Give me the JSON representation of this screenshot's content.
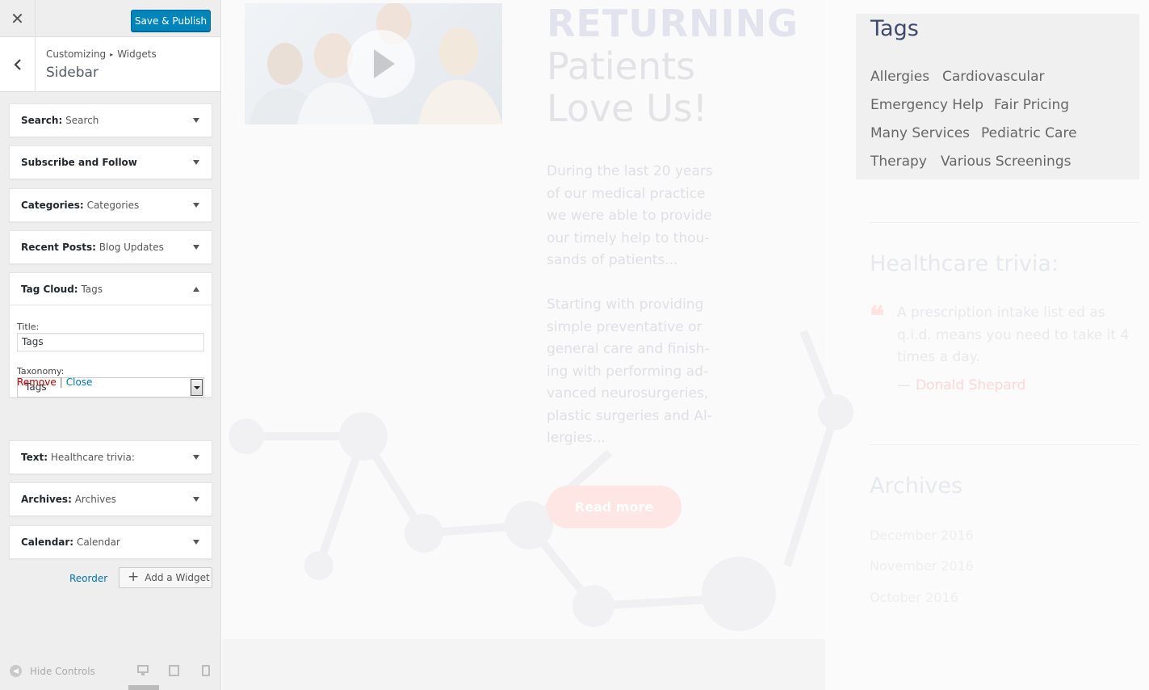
{
  "customizer": {
    "close_glyph": "✕",
    "save_label": "Save & Publish",
    "back_glyph": "‹",
    "breadcrumb_parent": "Customizing",
    "breadcrumb_separator": "▸",
    "breadcrumb_child": "Widgets",
    "panel_title": "Sidebar",
    "widgets": [
      {
        "label": "Search:",
        "title": "Search"
      },
      {
        "label": "Subscribe and Follow",
        "title": ""
      },
      {
        "label": "Categories:",
        "title": "Categories"
      },
      {
        "label": "Recent Posts:",
        "title": "Blog Updates"
      },
      {
        "label": "Tag Cloud:",
        "title": "Tags"
      },
      {
        "label": "Text:",
        "title": "Healthcare trivia:"
      },
      {
        "label": "Archives:",
        "title": "Archives"
      },
      {
        "label": "Calendar:",
        "title": "Calendar"
      }
    ],
    "open_widget": {
      "title_label": "Title:",
      "title_value": "Tags",
      "taxonomy_label": "Taxonomy:",
      "taxonomy_selected": "Tags",
      "remove_label": "Remove",
      "separator": "|",
      "close_label": "Close"
    },
    "reorder_label": "Reorder",
    "add_widget_plus": "+",
    "add_widget_label": "Add a Widget",
    "hide_controls_label": "Hide Controls",
    "hide_controls_glyph": "◀"
  },
  "preview": {
    "heading_top": "RETURNING",
    "heading_main": "Patients Love Us!",
    "paragraph_1": "During the last 20 years of our medical practice we were able to provide our timely help to thou-sands of patients...",
    "paragraph_2": "Starting with providing simple preventative or general care and finish-ing with performing ad-vanced neurosurgeries, plastic surgeries and Al-lergies...",
    "read_more": "Read more",
    "tags_title": "Tags",
    "tags": [
      "Allergies",
      "Cardiovascular",
      "Emergency Help",
      "Fair Pricing",
      "Many Services",
      "Pediatric Care",
      "Therapy",
      "Various Screenings"
    ],
    "trivia_title": "Healthcare trivia:",
    "quote_mark": "❝",
    "quote_text": "A prescription intake list ed as q.i.d. means you need to take it 4 times a day.",
    "quote_dash": "—",
    "quote_author": "Donald Shepard",
    "archives_title": "Archives",
    "archives": [
      "December 2016",
      "November 2016",
      "October 2016"
    ]
  },
  "colors": {
    "primary_button": "#0085ba",
    "accent_pink": "#fde6e4",
    "tags_heading": "#3f4a6d"
  },
  "icons": {
    "close": "close-icon",
    "back": "chevron-left-icon",
    "widget_toggle": "triangle-arrow-icon",
    "select": "dropdown-arrow-icon",
    "add": "plus-icon",
    "hide_controls": "collapse-icon",
    "devices": [
      "desktop-icon",
      "tablet-icon",
      "mobile-icon"
    ],
    "video": "play-icon",
    "quote": "quote-icon"
  }
}
